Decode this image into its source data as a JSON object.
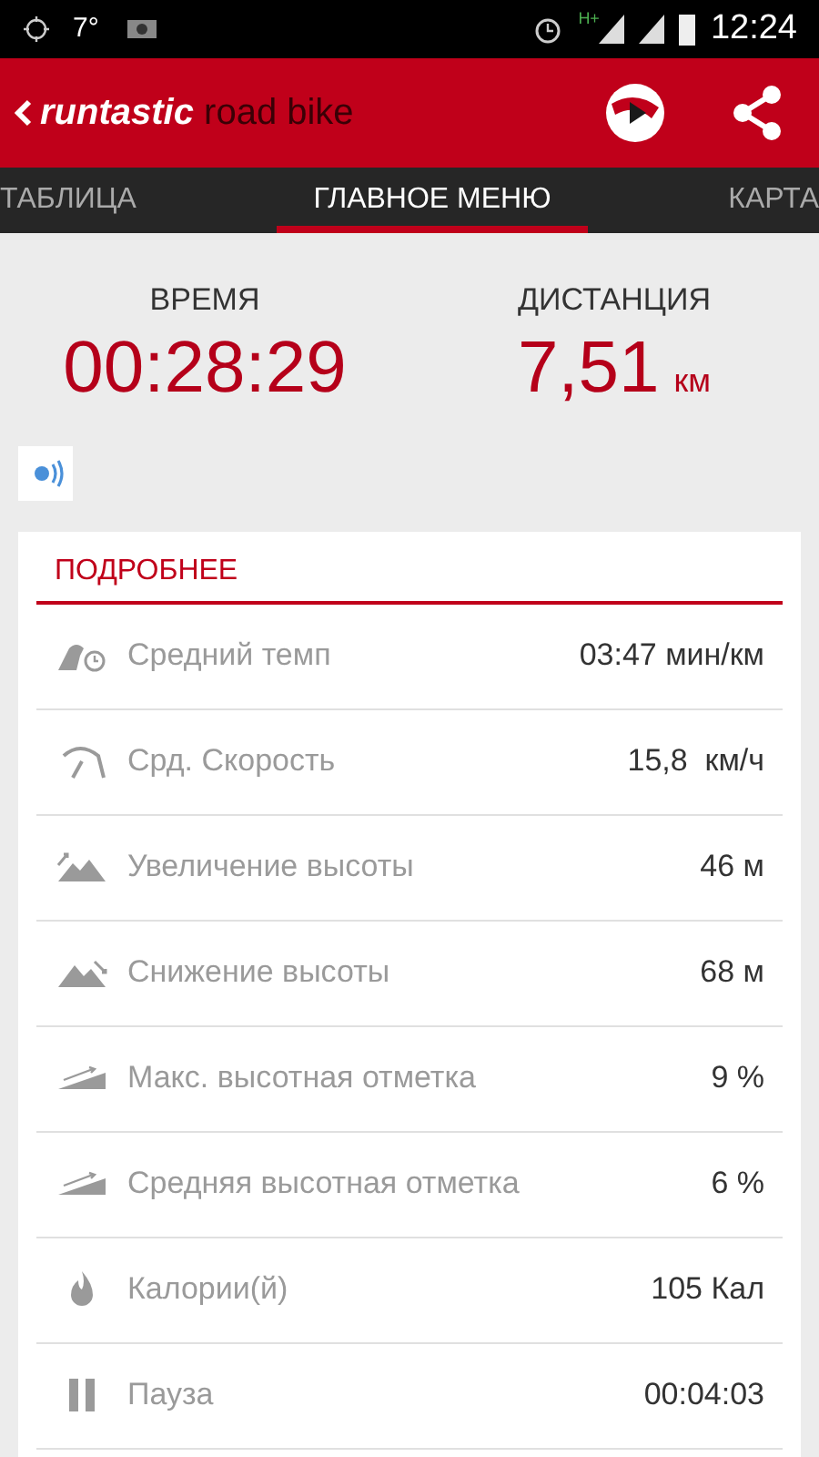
{
  "status_bar": {
    "temperature": "7°",
    "network": "H+",
    "time": "12:24"
  },
  "app_bar": {
    "brand": "runtastic",
    "product": "road bike"
  },
  "tabs": [
    {
      "label": "ТАБЛИЦА",
      "selected": false
    },
    {
      "label": "ГЛАВНОЕ МЕНЮ",
      "selected": true
    },
    {
      "label": "КАРТА",
      "selected": false
    }
  ],
  "summary": [
    {
      "label": "ВРЕМЯ",
      "value": "00:28:29"
    },
    {
      "label": "ДИСТАНЦИЯ",
      "value": "7,51",
      "unit": "км"
    }
  ],
  "details": {
    "title": "ПОДРОБНЕЕ",
    "rows": [
      {
        "kind": "pace",
        "label": "Средний темп",
        "value": "03:47 мин/км"
      },
      {
        "kind": "speed",
        "label": "Срд. Скорость",
        "value": "15,8  км/ч"
      },
      {
        "kind": "ascent",
        "label": "Увеличение высоты",
        "value": "46 м"
      },
      {
        "kind": "descent",
        "label": "Снижение высоты",
        "value": "68 м"
      },
      {
        "kind": "grade",
        "label": "Макс. высотная отметка",
        "value": "9 %"
      },
      {
        "kind": "grade",
        "label": "Средняя высотная отметка",
        "value": "6 %"
      },
      {
        "kind": "calories",
        "label": "Калории(й)",
        "value": "105 Кал"
      },
      {
        "kind": "pause",
        "label": "Пауза",
        "value": "00:04:03"
      }
    ]
  }
}
